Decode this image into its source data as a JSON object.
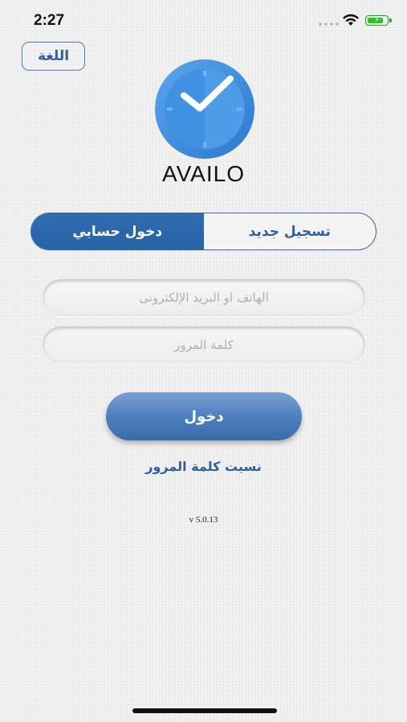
{
  "status_bar": {
    "time": "2:27"
  },
  "header": {
    "language_label": "اللغة"
  },
  "brand": {
    "app_name": "AVAILO",
    "logo_icon": "clock-icon",
    "logo_color": "#3d8ee0"
  },
  "tabs": {
    "register_label": "تسجيل جديد",
    "login_label": "دخول حسابي",
    "active": "login"
  },
  "form": {
    "phone_email_placeholder": "الهاتف او البريد الإلكترونى",
    "password_placeholder": "كلمة المرور",
    "login_button": "دخول",
    "forgot_password": "نسيت كلمة المرور"
  },
  "footer": {
    "version": "v 5.0.13"
  },
  "colors": {
    "accent": "#2f64a8",
    "button": "#4f7fbf",
    "background": "#efefef"
  }
}
